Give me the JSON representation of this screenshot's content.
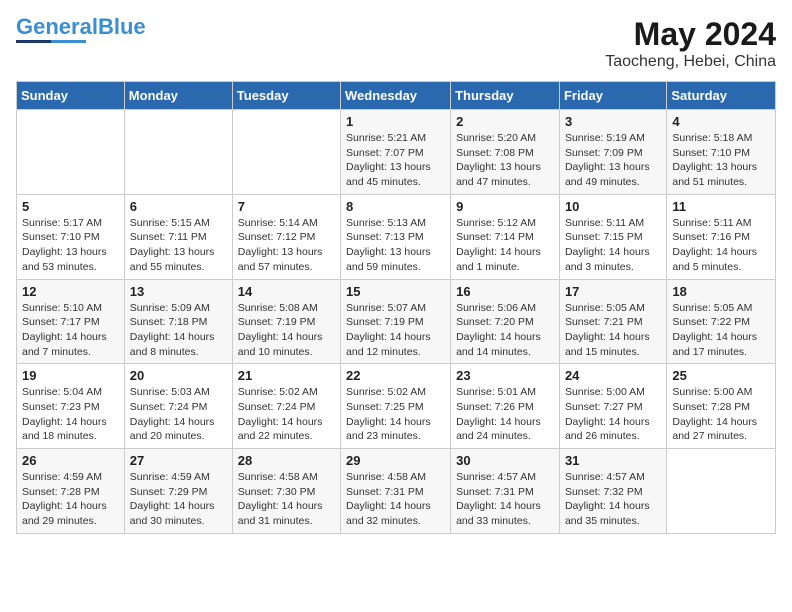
{
  "header": {
    "logo_main": "General",
    "logo_accent": "Blue",
    "month_year": "May 2024",
    "location": "Taocheng, Hebei, China"
  },
  "days_of_week": [
    "Sunday",
    "Monday",
    "Tuesday",
    "Wednesday",
    "Thursday",
    "Friday",
    "Saturday"
  ],
  "weeks": [
    [
      {
        "day": "",
        "info": ""
      },
      {
        "day": "",
        "info": ""
      },
      {
        "day": "",
        "info": ""
      },
      {
        "day": "1",
        "info": "Sunrise: 5:21 AM\nSunset: 7:07 PM\nDaylight: 13 hours and 45 minutes."
      },
      {
        "day": "2",
        "info": "Sunrise: 5:20 AM\nSunset: 7:08 PM\nDaylight: 13 hours and 47 minutes."
      },
      {
        "day": "3",
        "info": "Sunrise: 5:19 AM\nSunset: 7:09 PM\nDaylight: 13 hours and 49 minutes."
      },
      {
        "day": "4",
        "info": "Sunrise: 5:18 AM\nSunset: 7:10 PM\nDaylight: 13 hours and 51 minutes."
      }
    ],
    [
      {
        "day": "5",
        "info": "Sunrise: 5:17 AM\nSunset: 7:10 PM\nDaylight: 13 hours and 53 minutes."
      },
      {
        "day": "6",
        "info": "Sunrise: 5:15 AM\nSunset: 7:11 PM\nDaylight: 13 hours and 55 minutes."
      },
      {
        "day": "7",
        "info": "Sunrise: 5:14 AM\nSunset: 7:12 PM\nDaylight: 13 hours and 57 minutes."
      },
      {
        "day": "8",
        "info": "Sunrise: 5:13 AM\nSunset: 7:13 PM\nDaylight: 13 hours and 59 minutes."
      },
      {
        "day": "9",
        "info": "Sunrise: 5:12 AM\nSunset: 7:14 PM\nDaylight: 14 hours and 1 minute."
      },
      {
        "day": "10",
        "info": "Sunrise: 5:11 AM\nSunset: 7:15 PM\nDaylight: 14 hours and 3 minutes."
      },
      {
        "day": "11",
        "info": "Sunrise: 5:11 AM\nSunset: 7:16 PM\nDaylight: 14 hours and 5 minutes."
      }
    ],
    [
      {
        "day": "12",
        "info": "Sunrise: 5:10 AM\nSunset: 7:17 PM\nDaylight: 14 hours and 7 minutes."
      },
      {
        "day": "13",
        "info": "Sunrise: 5:09 AM\nSunset: 7:18 PM\nDaylight: 14 hours and 8 minutes."
      },
      {
        "day": "14",
        "info": "Sunrise: 5:08 AM\nSunset: 7:19 PM\nDaylight: 14 hours and 10 minutes."
      },
      {
        "day": "15",
        "info": "Sunrise: 5:07 AM\nSunset: 7:19 PM\nDaylight: 14 hours and 12 minutes."
      },
      {
        "day": "16",
        "info": "Sunrise: 5:06 AM\nSunset: 7:20 PM\nDaylight: 14 hours and 14 minutes."
      },
      {
        "day": "17",
        "info": "Sunrise: 5:05 AM\nSunset: 7:21 PM\nDaylight: 14 hours and 15 minutes."
      },
      {
        "day": "18",
        "info": "Sunrise: 5:05 AM\nSunset: 7:22 PM\nDaylight: 14 hours and 17 minutes."
      }
    ],
    [
      {
        "day": "19",
        "info": "Sunrise: 5:04 AM\nSunset: 7:23 PM\nDaylight: 14 hours and 18 minutes."
      },
      {
        "day": "20",
        "info": "Sunrise: 5:03 AM\nSunset: 7:24 PM\nDaylight: 14 hours and 20 minutes."
      },
      {
        "day": "21",
        "info": "Sunrise: 5:02 AM\nSunset: 7:24 PM\nDaylight: 14 hours and 22 minutes."
      },
      {
        "day": "22",
        "info": "Sunrise: 5:02 AM\nSunset: 7:25 PM\nDaylight: 14 hours and 23 minutes."
      },
      {
        "day": "23",
        "info": "Sunrise: 5:01 AM\nSunset: 7:26 PM\nDaylight: 14 hours and 24 minutes."
      },
      {
        "day": "24",
        "info": "Sunrise: 5:00 AM\nSunset: 7:27 PM\nDaylight: 14 hours and 26 minutes."
      },
      {
        "day": "25",
        "info": "Sunrise: 5:00 AM\nSunset: 7:28 PM\nDaylight: 14 hours and 27 minutes."
      }
    ],
    [
      {
        "day": "26",
        "info": "Sunrise: 4:59 AM\nSunset: 7:28 PM\nDaylight: 14 hours and 29 minutes."
      },
      {
        "day": "27",
        "info": "Sunrise: 4:59 AM\nSunset: 7:29 PM\nDaylight: 14 hours and 30 minutes."
      },
      {
        "day": "28",
        "info": "Sunrise: 4:58 AM\nSunset: 7:30 PM\nDaylight: 14 hours and 31 minutes."
      },
      {
        "day": "29",
        "info": "Sunrise: 4:58 AM\nSunset: 7:31 PM\nDaylight: 14 hours and 32 minutes."
      },
      {
        "day": "30",
        "info": "Sunrise: 4:57 AM\nSunset: 7:31 PM\nDaylight: 14 hours and 33 minutes."
      },
      {
        "day": "31",
        "info": "Sunrise: 4:57 AM\nSunset: 7:32 PM\nDaylight: 14 hours and 35 minutes."
      },
      {
        "day": "",
        "info": ""
      }
    ]
  ]
}
